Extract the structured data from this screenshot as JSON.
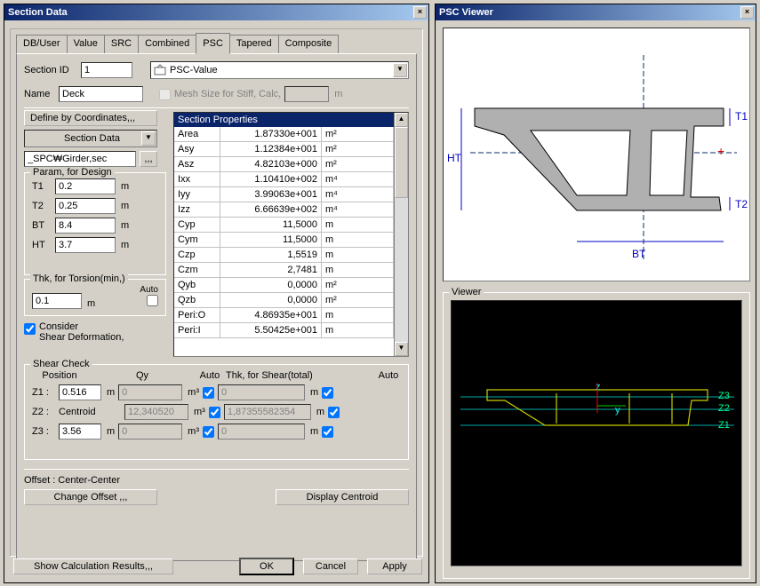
{
  "main_window": {
    "title": "Section Data",
    "tabs": [
      "DB/User",
      "Value",
      "SRC",
      "Combined",
      "PSC",
      "Tapered",
      "Composite"
    ],
    "active_tab": "PSC",
    "section_id_label": "Section ID",
    "section_id_value": "1",
    "psc_value_label": "PSC-Value",
    "name_label": "Name",
    "name_value": "Deck",
    "mesh_label": "Mesh Size for Stiff, Calc,",
    "define_by_coords": "Define by Coordinates,,,",
    "section_data_label": "Section Data",
    "filename": "_SPC₩Girder,sec",
    "ellipsis": ",,,",
    "param_design_legend": "Param, for Design",
    "params": [
      {
        "lbl": "T1",
        "val": "0.2",
        "unit": "m"
      },
      {
        "lbl": "T2",
        "val": "0.25",
        "unit": "m"
      },
      {
        "lbl": "BT",
        "val": "8.4",
        "unit": "m"
      },
      {
        "lbl": "HT",
        "val": "3.7",
        "unit": "m"
      }
    ],
    "thk_torsion_legend": "Thk, for Torsion(min,)",
    "thk_torsion_val": "0.1",
    "auto_label": "Auto",
    "consider_shear": "Consider\nShear Deformation,",
    "section_props_header": "Section Properties",
    "props": [
      {
        "k": "Area",
        "v": "1.87330e+001",
        "u": "m²"
      },
      {
        "k": "Asy",
        "v": "1.12384e+001",
        "u": "m²"
      },
      {
        "k": "Asz",
        "v": "4.82103e+000",
        "u": "m²"
      },
      {
        "k": "Ixx",
        "v": "1.10410e+002",
        "u": "m⁴"
      },
      {
        "k": "Iyy",
        "v": "3.99063e+001",
        "u": "m⁴"
      },
      {
        "k": "Izz",
        "v": "6.66639e+002",
        "u": "m⁴"
      },
      {
        "k": "Cyp",
        "v": "11,5000",
        "u": "m"
      },
      {
        "k": "Cym",
        "v": "11,5000",
        "u": "m"
      },
      {
        "k": "Czp",
        "v": "1,5519",
        "u": "m"
      },
      {
        "k": "Czm",
        "v": "2,7481",
        "u": "m"
      },
      {
        "k": "Qyb",
        "v": "0,0000",
        "u": "m²"
      },
      {
        "k": "Qzb",
        "v": "0,0000",
        "u": "m²"
      },
      {
        "k": "Peri:O",
        "v": "4.86935e+001",
        "u": "m"
      },
      {
        "k": "Peri:I",
        "v": "5.50425e+001",
        "u": "m"
      }
    ],
    "shear_check_legend": "Shear Check",
    "position_label": "Position",
    "qy_label": "Qy",
    "thk_shear_label": "Thk, for Shear(total)",
    "shear_rows": [
      {
        "lbl": "Z1 :",
        "pos": "0.516",
        "posunit": "m",
        "qy": "0",
        "qyunit": "m³",
        "thk": "0",
        "thkunit": "m"
      },
      {
        "lbl": "Z2 :",
        "posname": "Centroid",
        "qy": "12,340520",
        "qyunit": "m³",
        "thk": "1,87355582354",
        "thkunit": "m"
      },
      {
        "lbl": "Z3 :",
        "pos": "3.56",
        "posunit": "m",
        "qy": "0",
        "qyunit": "m³",
        "thk": "0",
        "thkunit": "m"
      }
    ],
    "offset_label": "Offset :  Center-Center",
    "change_offset_btn": "Change Offset ,,,",
    "display_centroid_btn": "Display Centroid",
    "show_calc_btn": "Show Calculation Results,,,",
    "ok_btn": "OK",
    "cancel_btn": "Cancel",
    "apply_btn": "Apply"
  },
  "viewer_window": {
    "title": "PSC Viewer",
    "viewer_legend": "Viewer",
    "dim_HT": "HT",
    "dim_BT": "BT",
    "dim_T1": "T1",
    "dim_T2": "T2",
    "axisY": "y",
    "axisZ": "z",
    "Z1": "Z1",
    "Z2": "Z2",
    "Z3": "Z3"
  }
}
